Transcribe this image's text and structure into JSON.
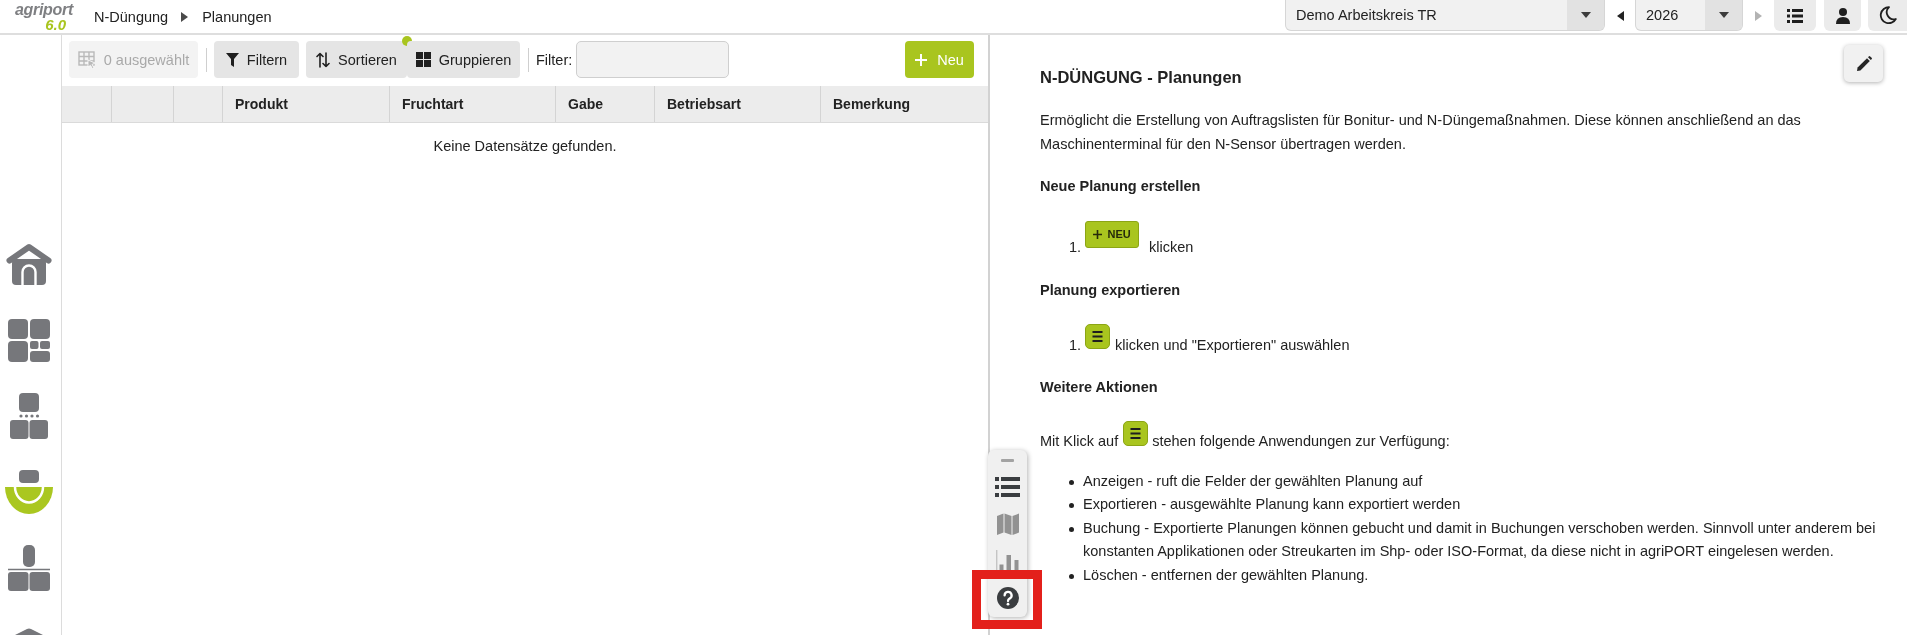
{
  "topbar": {
    "logo": {
      "name": "agriport",
      "version": "6.0"
    },
    "breadcrumb": [
      {
        "label": "N-Düngung"
      },
      {
        "label": "Planungen"
      }
    ],
    "organization": {
      "value": "Demo Arbeitskreis TR"
    },
    "year": {
      "value": "2026",
      "previous": {
        "disabled": false
      },
      "next": {
        "disabled": true
      }
    },
    "buttons": [
      {
        "kind": "list"
      },
      {
        "kind": "user"
      },
      {
        "kind": "theme"
      }
    ]
  },
  "sidebar": {
    "items": [
      {
        "kind": "home",
        "selected": false
      },
      {
        "kind": "tiles",
        "selected": false
      },
      {
        "kind": "blocks",
        "selected": false
      },
      {
        "kind": "bowl",
        "selected": true
      },
      {
        "kind": "pillar",
        "selected": false
      },
      {
        "kind": "peak",
        "selected": false
      }
    ]
  },
  "toolbar": {
    "selection": {
      "label": "0 ausgewählt",
      "disabled": true
    },
    "buttons": [
      {
        "kind": "filter",
        "label": "Filtern",
        "indicator": false
      },
      {
        "kind": "sort",
        "label": "Sortieren",
        "indicator": true
      },
      {
        "kind": "group",
        "label": "Gruppieren",
        "indicator": false
      }
    ],
    "filter": {
      "label": "Filter:"
    },
    "new_button": {
      "label": "Neu"
    }
  },
  "table": {
    "columns": [
      {
        "kind": "blank"
      },
      {
        "kind": "blank"
      },
      {
        "kind": "blank"
      },
      {
        "kind": "text",
        "label": "Produkt"
      },
      {
        "kind": "text",
        "label": "Fruchtart"
      },
      {
        "kind": "text",
        "label": "Gabe"
      },
      {
        "kind": "text",
        "label": "Betriebsart"
      },
      {
        "kind": "text",
        "label": "Bemerkung"
      }
    ],
    "empty_message": "Keine Datensätze gefunden."
  },
  "help": {
    "title": "N-DÜNGUNG - Planungen",
    "intro": "Ermöglicht die Erstellung von Auftragslisten für Bonitur- und N-Düngemaßnahmen. Diese können anschließend an das Maschinenterminal für den N-Sensor übertragen werden.",
    "sections": [
      {
        "heading": "Neue Planung erstellen",
        "steps": [
          {
            "number": "1.",
            "parts": [
              {
                "kind": "button",
                "label": "NEU"
              },
              {
                "kind": "text",
                "text": "klicken"
              }
            ]
          }
        ]
      },
      {
        "heading": "Planung exportieren",
        "steps": [
          {
            "number": "1.",
            "parts": [
              {
                "kind": "menu"
              },
              {
                "kind": "text",
                "text": "klicken und \"Exportieren\" auswählen"
              }
            ]
          }
        ]
      },
      {
        "heading": "Weitere Aktionen",
        "lead": [
          {
            "kind": "text",
            "text": "Mit Klick auf"
          },
          {
            "kind": "menu"
          },
          {
            "kind": "text",
            "text": "stehen folgende Anwendungen zur Verfügung:"
          }
        ],
        "bullets": [
          "Anzeigen - ruft die Felder der gewählten Planung auf",
          "Exportieren - ausgewählte Planung kann exportiert werden",
          "Buchung - Exportierte Planungen können gebucht und damit in Buchungen verschoben werden. Sinnvoll unter anderem bei konstanten Applikationen oder Streukarten im Shp- oder ISO-Format, da diese nicht in agriPORT eingelesen werden.",
          "Löschen - entfernen der gewählten Planung."
        ]
      }
    ]
  },
  "floating_toolbar": {
    "items": [
      {
        "kind": "list",
        "selected": true,
        "highlighted": false
      },
      {
        "kind": "map",
        "selected": false,
        "highlighted": false
      },
      {
        "kind": "chart",
        "selected": false,
        "highlighted": false
      },
      {
        "kind": "help",
        "selected": true,
        "highlighted": true
      }
    ]
  }
}
